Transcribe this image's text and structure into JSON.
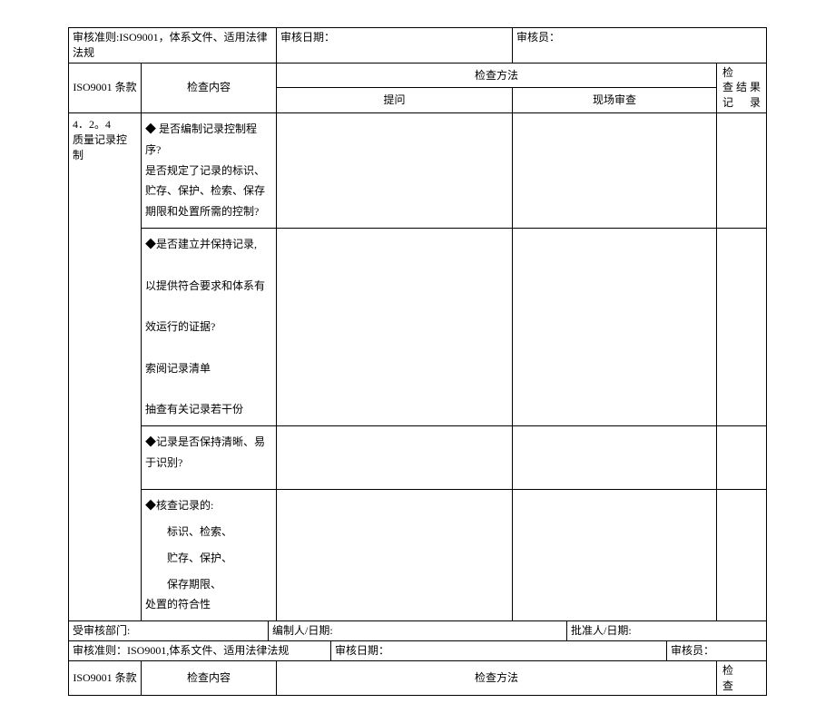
{
  "table1": {
    "row1": {
      "criteria_label": "审核准则:ISO9001，体系文件、适用法律法规",
      "date_label": "审核日期：",
      "auditor_label": "审核员："
    },
    "headers": {
      "clause": "ISO9001 条款",
      "content": "检查内容",
      "method": "检查方法",
      "question": "提问",
      "onsite": "现场审查",
      "result": "检　　查结果记录"
    },
    "body": {
      "clause_num": "4．2。4",
      "clause_title": "质量记录控制",
      "content1": "◆ 是否编制记录控制程序?\n是否规定了记录的标识、贮存、保护、检索、保存期限和处置所需的控制?",
      "content2": "◆是否建立并保持记录,\n\n以提供符合要求和体系有\n\n效运行的证据?\n\n索阅记录清单\n\n抽查有关记录若干份",
      "content3": "◆记录是否保持清晰、易\n于识别?",
      "content4_lead": "◆核查记录的:",
      "content4_items": [
        "标识、检索、",
        "贮存、保护、",
        "保存期限、"
      ],
      "content4_last": "处置的符合性"
    },
    "footer": {
      "dept_label": "受审核部门:",
      "compiler_label": "编制人/日期:",
      "approver_label": "批准人/日期:"
    }
  },
  "table2": {
    "row1": {
      "criteria_label": "审核准则：ISO9001,体系文件、适用法律法规",
      "date_label": "审核日期：",
      "auditor_label": "审核员："
    },
    "headers": {
      "clause": "ISO9001 条款",
      "content": "检查内容",
      "method": "检查方法",
      "result": "检　　查"
    }
  }
}
